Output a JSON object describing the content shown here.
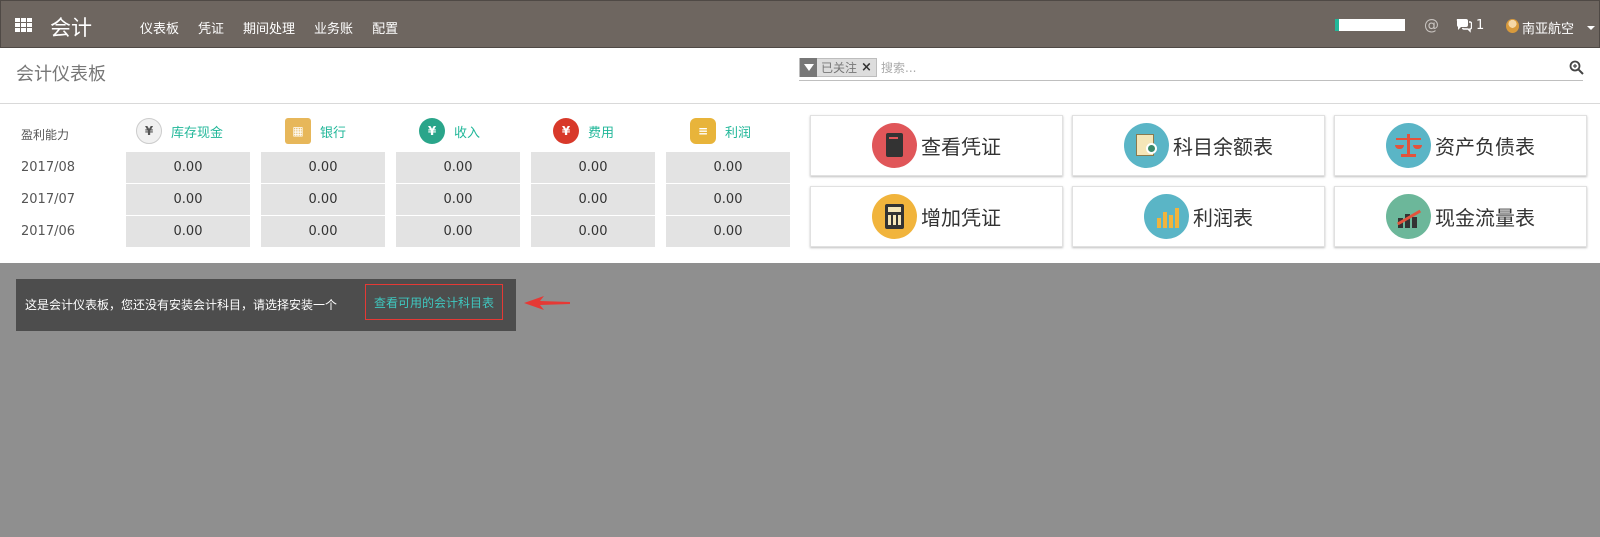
{
  "navbar": {
    "app_title": "会计",
    "menu": [
      "仪表板",
      "凭证",
      "期间处理",
      "业务账",
      "配置"
    ],
    "chat_count": "1",
    "user_name": "南亚航空",
    "accent_color": "#21b799",
    "bg_color": "#6e6660"
  },
  "control_panel": {
    "breadcrumb": "会计仪表板",
    "facet_label": "已关注",
    "facet_remove": "×",
    "search_placeholder": "搜索..."
  },
  "dashboard": {
    "profit_label": "盈利能力",
    "columns": [
      {
        "label": "库存现金",
        "icon": "cash-icon"
      },
      {
        "label": "银行",
        "icon": "bank-icon"
      },
      {
        "label": "收入",
        "icon": "income-icon"
      },
      {
        "label": "费用",
        "icon": "expense-icon"
      },
      {
        "label": "利润",
        "icon": "profit-coins-icon"
      }
    ],
    "rows": [
      {
        "period": "2017/08",
        "values": [
          "0.00",
          "0.00",
          "0.00",
          "0.00",
          "0.00"
        ]
      },
      {
        "period": "2017/07",
        "values": [
          "0.00",
          "0.00",
          "0.00",
          "0.00",
          "0.00"
        ]
      },
      {
        "period": "2017/06",
        "values": [
          "0.00",
          "0.00",
          "0.00",
          "0.00",
          "0.00"
        ]
      }
    ],
    "tiles": [
      {
        "label": "查看凭证",
        "icon": "voucher-book-icon",
        "color": "#e05659"
      },
      {
        "label": "科目余额表",
        "icon": "balance-sheet-icon",
        "color": "#5ab5c6"
      },
      {
        "label": "资产负债表",
        "icon": "scale-icon",
        "color": "#5ab5c6"
      },
      {
        "label": "增加凭证",
        "icon": "calculator-icon",
        "color": "#f1b43c"
      },
      {
        "label": "利润表",
        "icon": "bar-chart-icon",
        "color": "#5ab5c6"
      },
      {
        "label": "现金流量表",
        "icon": "trend-chart-icon",
        "color": "#6cb79a"
      }
    ]
  },
  "alert": {
    "text": "这是会计仪表板，您还没有安装会计科目，请选择安装一个",
    "link": "查看可用的会计科目表"
  }
}
